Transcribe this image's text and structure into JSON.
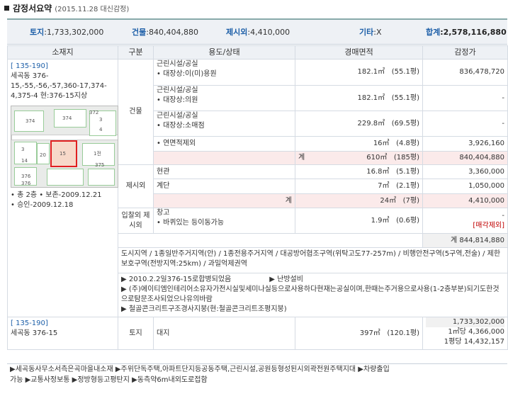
{
  "header": {
    "title": "감정서요약",
    "date": "(2015.11.28 대신감정)"
  },
  "summary": {
    "land_label": "토지",
    "land_value": ":1,733,302,000",
    "building_label": "건물",
    "building_value": ":840,404,880",
    "exclusion_label": "제시외",
    "exclusion_value": ":4,410,000",
    "other_label": "기타",
    "other_value": ":X",
    "total_label": "합계",
    "total_value": ":2,578,116,880"
  },
  "columns": [
    "소재지",
    "구분",
    "용도/상태",
    "경매면적",
    "감정가"
  ],
  "location": {
    "code": "[ 135-190]",
    "address": "세곡동 376-15,-55,-56,-57,360-17,374-4,375-4 현:376-15지상",
    "notes": [
      "• 총 2층  • 보존-2009.12.21",
      "• 승인-2009.12.18"
    ]
  },
  "map": {
    "labels": [
      "374",
      "374",
      "3",
      "14",
      "20",
      "15",
      "376",
      "376",
      "375",
      "1전",
      "3",
      "4",
      "372"
    ]
  },
  "building": {
    "category": "건물",
    "rows": [
      {
        "use": "근린시설/공실",
        "sub": "• 대장상:이(미)용원",
        "area": "182.1㎡",
        "pyeong": "(55.1평)",
        "price": "836,478,720"
      },
      {
        "use": "근린시설/공실",
        "sub": "• 대장상:의원",
        "area": "182.1㎡",
        "pyeong": "(55.1평)",
        "price": "-"
      },
      {
        "use": "근린시설/공실",
        "sub": "• 대장상:소매점",
        "area": "229.8㎡",
        "pyeong": "(69.5평)",
        "price": "-"
      },
      {
        "use": "",
        "sub": "• 연면적제외",
        "area": "16㎡",
        "pyeong": "(4.8평)",
        "price": "3,926,160"
      }
    ],
    "subtotal": {
      "label": "계",
      "area": "610㎡",
      "pyeong": "(185평)",
      "price": "840,404,880"
    }
  },
  "exclusion": {
    "category": "제시외",
    "rows": [
      {
        "use": "현관",
        "area": "16.8㎡",
        "pyeong": "(5.1평)",
        "price": "3,360,000"
      },
      {
        "use": "계단",
        "area": "7㎡",
        "pyeong": "(2.1평)",
        "price": "1,050,000"
      }
    ],
    "subtotal": {
      "label": "계",
      "area": "24㎡",
      "pyeong": "(7평)",
      "price": "4,410,000"
    }
  },
  "included": {
    "category": "입찰외 제시외",
    "use": "창고",
    "sub": "• 바퀴있는 등이동가능",
    "area": "1.9㎡",
    "pyeong": "(0.6평)",
    "price": "-",
    "note": "[매각제외]"
  },
  "grand_total": "계 844,814,880",
  "zoning": "도시지역 / 1종일반주거지역(안) / 1종전용주거지역 / 대공방어협조구역(위탁고도77-257m) / 비행안전구역(5구역,전술) / 제한보호구역(전방지역:25km) / 과밀억제권역",
  "notes": [
    "▶ 2010.2.2일376-15로합병되었음",
    "▶ 난방설비",
    "▶ (주)에이티엠인테리어소유자가전시실및세미나실등으로사용하다현재는공실이며,한때는주거용으로사용(1-2층부분)되기도한것으로탐문조사되었으나유의바람",
    "▶ 철골콘크리트구조경사지붕(현:철골콘크리트조평지붕)"
  ],
  "land": {
    "code": "[ 135-190]",
    "address": "세곡동 376-15",
    "category": "토지",
    "use": "대지",
    "area": "397㎡",
    "pyeong": "(120.1평)",
    "price": "1,733,302,000",
    "unit1": "1㎡당 4,366,000",
    "unit2": "1평당 14,432,157"
  },
  "footer": {
    "line1": "▶세곡동사무소서측은곡마을내소재  ▶주위단독주택,아파트단지등공동주택,근린시설,공원등형성된시외곽전원주택지대  ▶차량출입",
    "line2": "가능  ▶교통사정보통  ▶정방형등고평탄지  ▶동측약6m내외도로접함"
  }
}
